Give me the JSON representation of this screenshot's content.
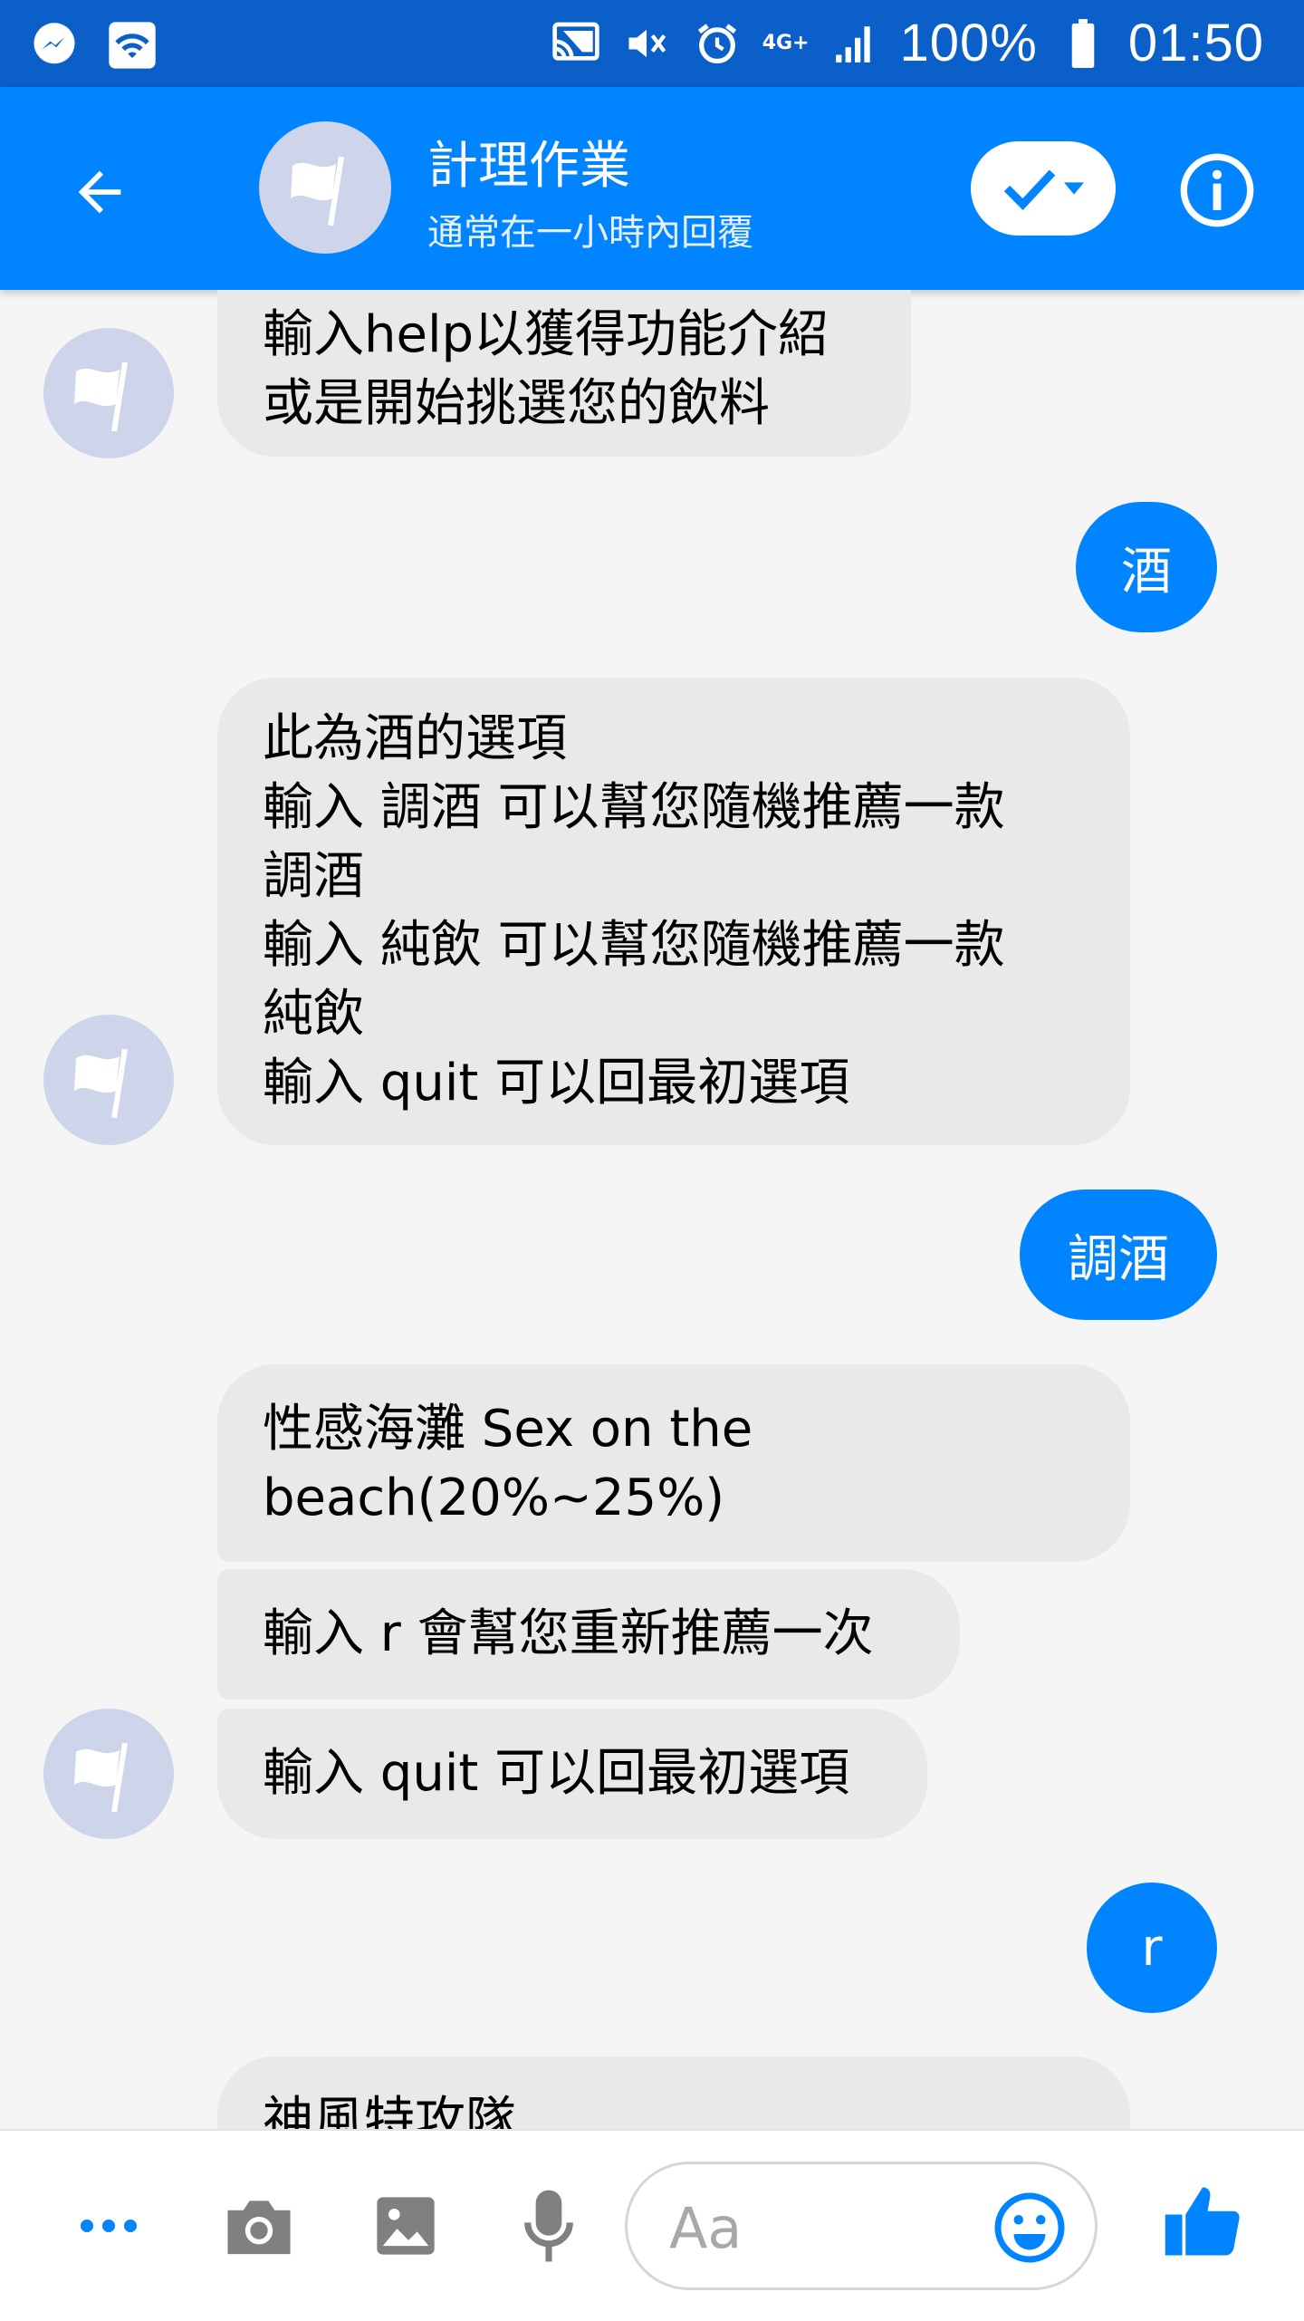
{
  "status_bar": {
    "battery": "100%",
    "time": "01:50",
    "network": "4G+"
  },
  "header": {
    "title": "計理作業",
    "subtitle": "通常在一小時內回覆"
  },
  "messages": [
    {
      "from": "bot",
      "text": "輸入help以獲得功能介紹\n或是開始挑選您的飲料"
    },
    {
      "from": "user",
      "text": "酒"
    },
    {
      "from": "bot",
      "text": "此為酒的選項\n輸入 調酒 可以幫您隨機推薦一款\n調酒\n輸入 純飲 可以幫您隨機推薦一款\n純飲\n輸入 quit 可以回最初選項"
    },
    {
      "from": "user",
      "text": "調酒"
    },
    {
      "from": "bot",
      "text": "性感海灘 Sex on the\nbeach(20%~25%)"
    },
    {
      "from": "bot",
      "text": "輸入 r 會幫您重新推薦一次"
    },
    {
      "from": "bot",
      "text": "輸入 quit 可以回最初選項"
    },
    {
      "from": "user",
      "text": "r"
    },
    {
      "from": "bot",
      "text": "神風特攻隊"
    }
  ],
  "composer": {
    "placeholder": "Aa"
  },
  "colors": {
    "brand": "#0084ff",
    "status_bar": "#0b5fc9",
    "bubble_in": "#e9e9e9",
    "avatar": "#ced4ea"
  }
}
